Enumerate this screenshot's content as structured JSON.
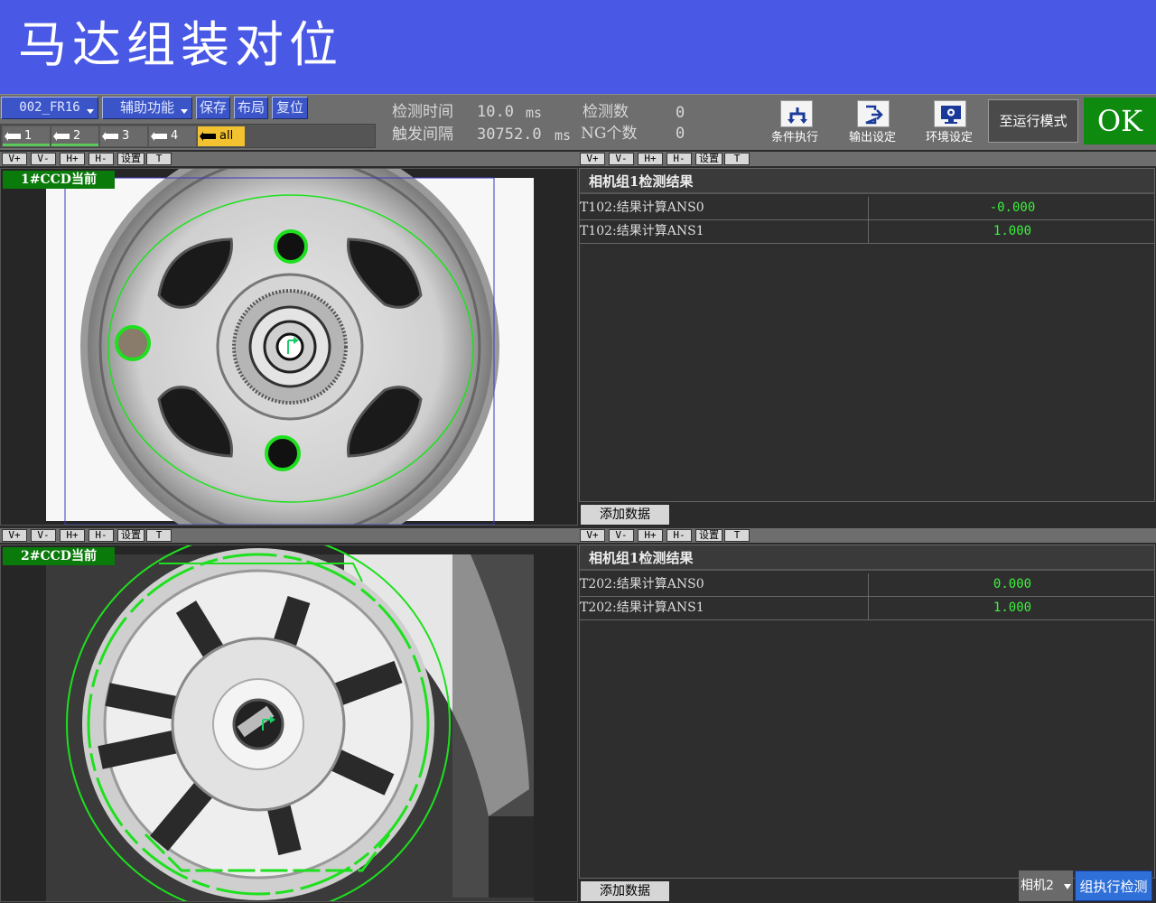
{
  "title": "马达组装对位",
  "toolbar": {
    "program_select": "002_FR16",
    "aux_menu": "辅助功能",
    "save": "保存",
    "layout": "布局",
    "reset": "复位",
    "camera_tabs": [
      "1",
      "2",
      "3",
      "4",
      "all"
    ],
    "selected_camera_tab": "all"
  },
  "status": {
    "detect_time_label": "检测时间",
    "detect_time_value": "10.0",
    "detect_time_unit": "ms",
    "trigger_interval_label": "触发间隔",
    "trigger_interval_value": "30752.0",
    "trigger_interval_unit": "ms",
    "detect_count_label": "检测数",
    "detect_count_value": "0",
    "ng_count_label": "NG个数",
    "ng_count_value": "0"
  },
  "tools": {
    "condition_exec": "条件执行",
    "output_settings": "输出设定",
    "env_settings": "环境设定",
    "to_run_mode": "至运行模式",
    "result": "OK"
  },
  "view_buttons": [
    "V+",
    "V-",
    "H+",
    "H-",
    "设置",
    "T"
  ],
  "panels": [
    {
      "ccd_label": "1#CCD当前",
      "result_title": "相机组1检测结果",
      "rows": [
        {
          "name": "T102:结果计算ANS0",
          "value": "-0.000"
        },
        {
          "name": "T102:结果计算ANS1",
          "value": "1.000"
        }
      ],
      "add_data": "添加数据"
    },
    {
      "ccd_label": "2#CCD当前",
      "result_title": "相机组1检测结果",
      "rows": [
        {
          "name": "T202:结果计算ANS0",
          "value": "0.000"
        },
        {
          "name": "T202:结果计算ANS1",
          "value": "1.000"
        }
      ],
      "add_data": "添加数据"
    }
  ],
  "footer": {
    "camera_select": "相机2",
    "group_exec_button": "组执行检测"
  },
  "colors": {
    "title_bar": "#4a58e6",
    "ok_green": "#0e8a0e",
    "value_green": "#3cf03c",
    "overlay_green": "#1ee01e"
  }
}
